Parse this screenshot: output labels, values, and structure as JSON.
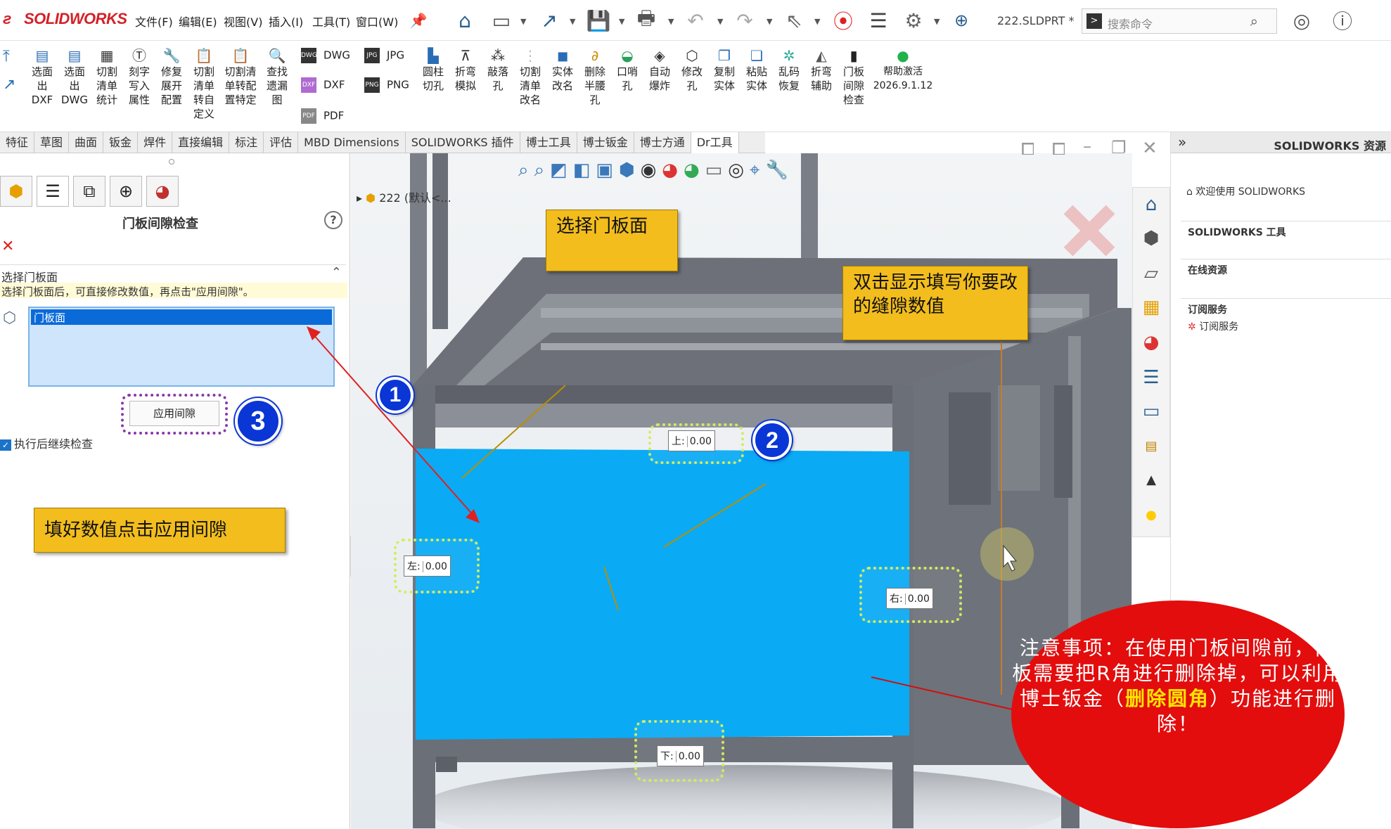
{
  "app": {
    "logo_text": "SOLIDWORKS",
    "file_name": "222.SLDPRT *",
    "search_placeholder": "搜索命令"
  },
  "menu": [
    "文件(F)",
    "编辑(E)",
    "视图(V)",
    "插入(I)",
    "工具(T)",
    "窗口(W)"
  ],
  "ribbon": {
    "commands": [
      {
        "label": "选面\n出\nDXF",
        "icon": "export-icon"
      },
      {
        "label": "选面\n出\nDWG",
        "icon": "dwg-icon"
      },
      {
        "label": "切割\n清单\n统计",
        "icon": "list-icon"
      },
      {
        "label": "刻字\n写入\n属性",
        "icon": "engrave-icon"
      },
      {
        "label": "修复\n展开\n配置",
        "icon": "wrench-icon"
      },
      {
        "label": "切割\n清单\n转自\n定义",
        "icon": "clipboard-icon"
      },
      {
        "label": "切割清\n单转配\n置特定",
        "icon": "clipboard-icon"
      },
      {
        "label": "查找\n遗漏\n图",
        "icon": "search-icon"
      }
    ],
    "exports": [
      "DWG",
      "JPG",
      "DXF",
      "PNG",
      "PDF"
    ],
    "commands2": [
      {
        "label": "圆柱\n切孔",
        "icon": "cylinder-icon"
      },
      {
        "label": "折弯\n模拟",
        "icon": "bend-icon"
      },
      {
        "label": "敲落\n孔",
        "icon": "knockout-icon"
      },
      {
        "label": "切割\n清单\n改名",
        "icon": "rename-icon"
      },
      {
        "label": "实体\n改名",
        "icon": "solid-icon"
      },
      {
        "label": "删除\n半腰\n孔",
        "icon": "delete-hole-icon"
      },
      {
        "label": "口哨\n孔",
        "icon": "whistle-icon"
      },
      {
        "label": "自动\n爆炸",
        "icon": "explode-icon"
      },
      {
        "label": "修改\n孔",
        "icon": "hole-icon"
      },
      {
        "label": "复制\n实体",
        "icon": "copy-icon"
      },
      {
        "label": "粘贴\n实体",
        "icon": "paste-icon"
      },
      {
        "label": "乱码\n恢复",
        "icon": "restore-icon"
      },
      {
        "label": "折弯\n辅助",
        "icon": "bend-aid-icon"
      },
      {
        "label": "门板\n间隙\n检查",
        "icon": "door-gap-icon"
      },
      {
        "label": "帮助激活\n2026.9.1.12",
        "icon": "wechat-icon"
      }
    ]
  },
  "tabs": [
    "特征",
    "草图",
    "曲面",
    "钣金",
    "焊件",
    "直接编辑",
    "标注",
    "评估",
    "MBD Dimensions",
    "SOLIDWORKS 插件",
    "博士工具",
    "博士钣金",
    "博士方通",
    "Dr工具"
  ],
  "panel": {
    "title": "门板间隙检查",
    "section_title": "选择门板面",
    "hint": "选择门板面后，可直接修改数值，再点击\"应用间隙\"。",
    "selected_item": "门板面",
    "apply_button": "应用间隙",
    "continue_check_label": "执行后继续检查",
    "continue_check_checked": true
  },
  "viewport": {
    "tree_item": "222 (默认<..."
  },
  "gaps": {
    "top": {
      "label": "上:",
      "value": "0.00"
    },
    "left": {
      "label": "左:",
      "value": "0.00"
    },
    "right": {
      "label": "右:",
      "value": "0.00"
    },
    "bottom": {
      "label": "下:",
      "value": "0.00"
    }
  },
  "callouts": {
    "step1": "选择门板面",
    "step2": "双击显示填写你要改的缝隙数值",
    "step3": "填好数值点击应用间隙",
    "badge1": "1",
    "badge2": "2",
    "badge3": "3"
  },
  "note": {
    "part1": "注意事项：在使用门板间隙前，门板需要把R角进行删除掉，可以利用博士钣金（",
    "highlight": "删除圆角",
    "part2": "）功能进行删除！"
  },
  "resources": {
    "header": "SOLIDWORKS 资源",
    "welcome": "欢迎使用 SOLIDWORKS",
    "tools": "SOLIDWORKS 工具",
    "online": "在线资源",
    "subscription": "订阅服务",
    "subscription_item": "订阅服务"
  },
  "colors": {
    "door_panel": "#0aaaf5",
    "callout": "#f2bd1d",
    "badge": "#0b36d6",
    "note": "#e30d0d",
    "frame": "#6d7079"
  }
}
